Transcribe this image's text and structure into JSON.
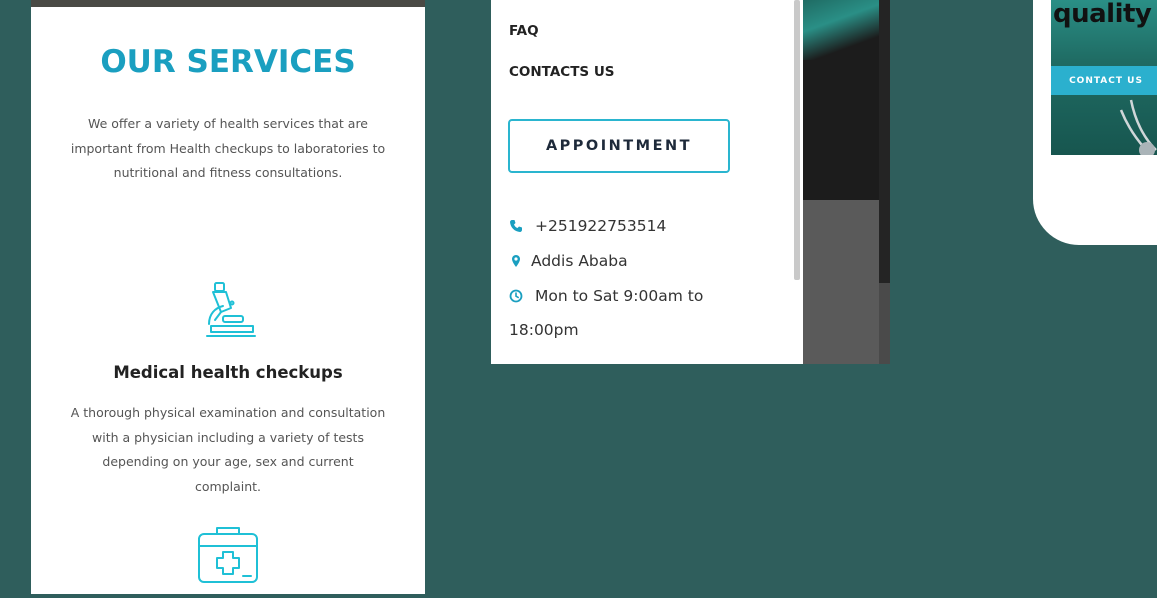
{
  "services": {
    "title": "OUR SERVICES",
    "intro_lines": [
      "We offer a variety of health services that are",
      "important from Health checkups to laboratories to",
      "nutritional and fitness consultations."
    ],
    "items": [
      {
        "icon": "microscope-icon",
        "title": "Medical health checkups",
        "desc_lines": [
          "A thorough physical examination and consultation",
          "with a physician including a variety of tests",
          "depending on your age, sex and current",
          "complaint."
        ]
      },
      {
        "icon": "first-aid-kit-icon"
      }
    ]
  },
  "menu": {
    "links": [
      "FAQ",
      "CONTACTS US"
    ],
    "appointment_label": "APPOINTMENT",
    "phone": "+251922753514",
    "location": "Addis Ababa",
    "hours_line1": "Mon to Sat 9:00am to",
    "hours_line2": "18:00pm"
  },
  "hero": {
    "headline_visible": "quality",
    "contact_label": "CONTACT US"
  },
  "colors": {
    "background": "#2f5e5c",
    "accent": "#1a9fc0",
    "button": "#2bb0ce"
  }
}
